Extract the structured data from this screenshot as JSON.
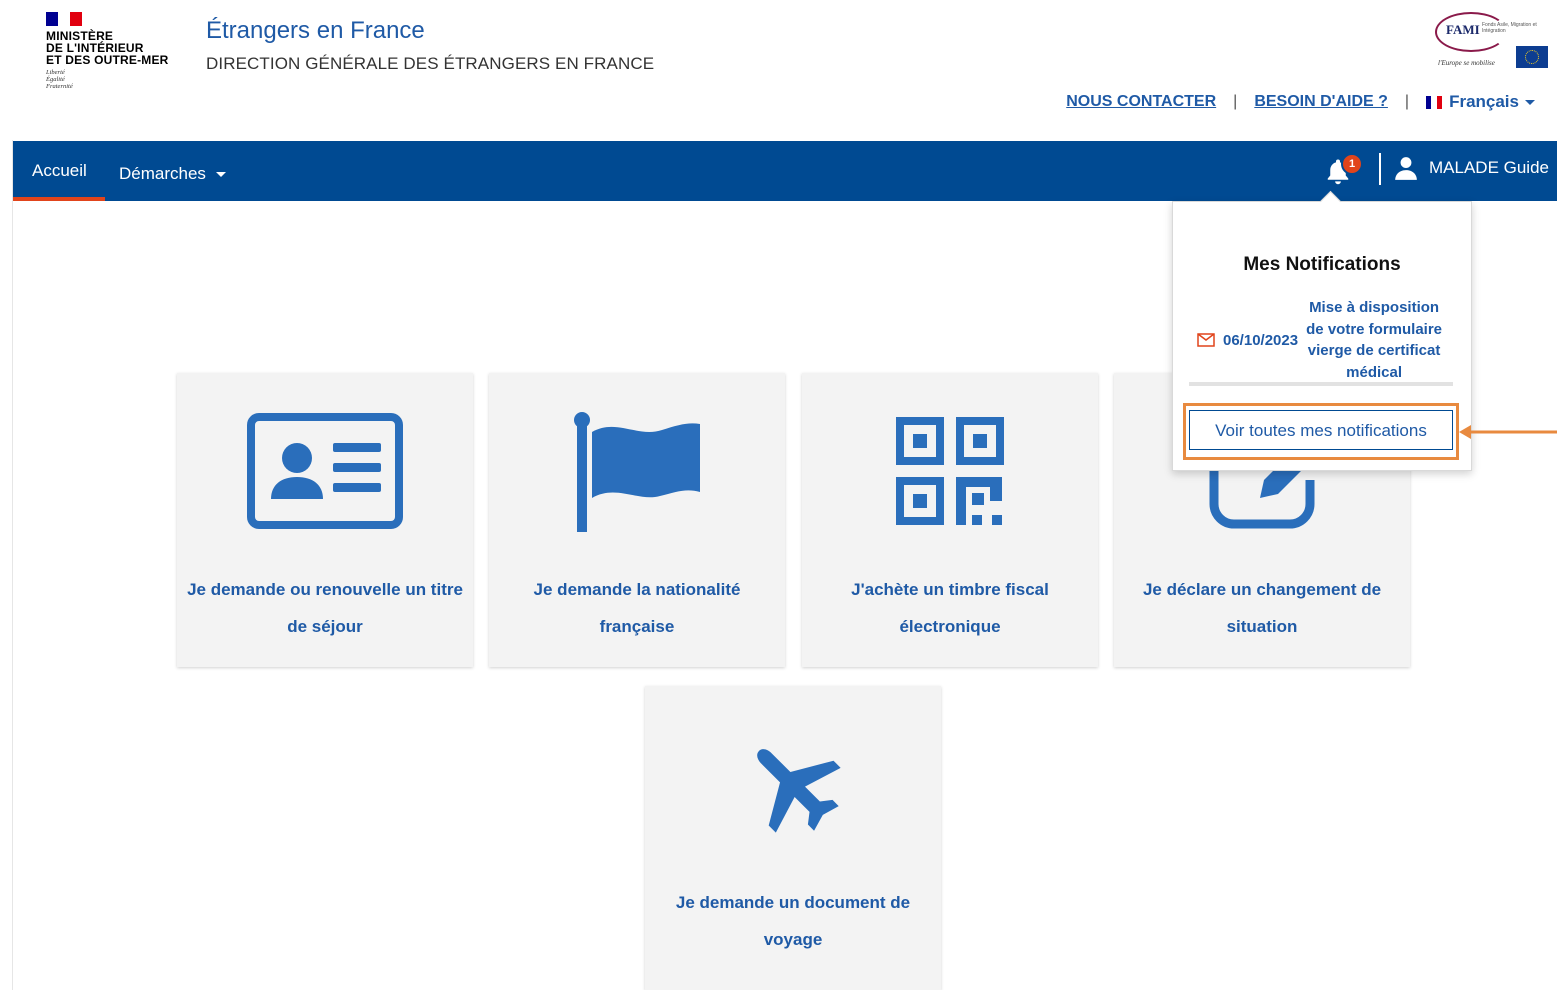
{
  "header": {
    "ministry_lines": [
      "MINISTÈRE",
      "DE L'INTÉRIEUR",
      "ET DES OUTRE-MER"
    ],
    "motto_lines": [
      "Liberté",
      "Égalité",
      "Fraternité"
    ],
    "site_title": "Étrangers en France",
    "site_subtitle": "DIRECTION GÉNÉRALE DES ÉTRANGERS EN FRANCE",
    "fami_logo": {
      "word": "FAMI",
      "small_text": "Fonds Asile, Migration et Intégration",
      "tagline": "l'Europe se mobilise"
    },
    "links": {
      "contact": "NOUS CONTACTER",
      "help": "BESOIN D'AIDE ?",
      "separator": "|",
      "language": "Français"
    },
    "colors": {
      "flag_blue": "#000091",
      "flag_white": "#ffffff",
      "flag_red": "#e1000f"
    }
  },
  "navbar": {
    "home": "Accueil",
    "demarches": "Démarches",
    "notification_count": "1",
    "user_name": "MALADE Guide",
    "colors": {
      "background": "#004a92",
      "active_underline": "#e1441b",
      "badge": "#e1441b"
    }
  },
  "notifications": {
    "title": "Mes Notifications",
    "items": [
      {
        "icon": "envelope-icon",
        "date": "06/10/2023",
        "message_lines": [
          "Mise à disposition",
          "de votre formulaire",
          "vierge de certificat",
          "médical"
        ]
      }
    ],
    "see_all": "Voir toutes mes notifications"
  },
  "annotation": {
    "highlight_color": "#e88a3f"
  },
  "cards": [
    {
      "icon": "id-card-icon",
      "label_lines": [
        "Je demande ou renouvelle un titre",
        "de séjour"
      ]
    },
    {
      "icon": "flag-icon",
      "label_lines": [
        "Je demande la nationalité",
        "française"
      ]
    },
    {
      "icon": "qr-code-icon",
      "label_lines": [
        "J'achète un timbre fiscal",
        "électronique"
      ]
    },
    {
      "icon": "edit-box-icon",
      "label_lines": [
        "Je déclare un changement de",
        "situation"
      ]
    },
    {
      "icon": "airplane-icon",
      "label_lines": [
        "Je demande un document de",
        "voyage"
      ]
    }
  ],
  "accent_color": "#2a6ebb"
}
